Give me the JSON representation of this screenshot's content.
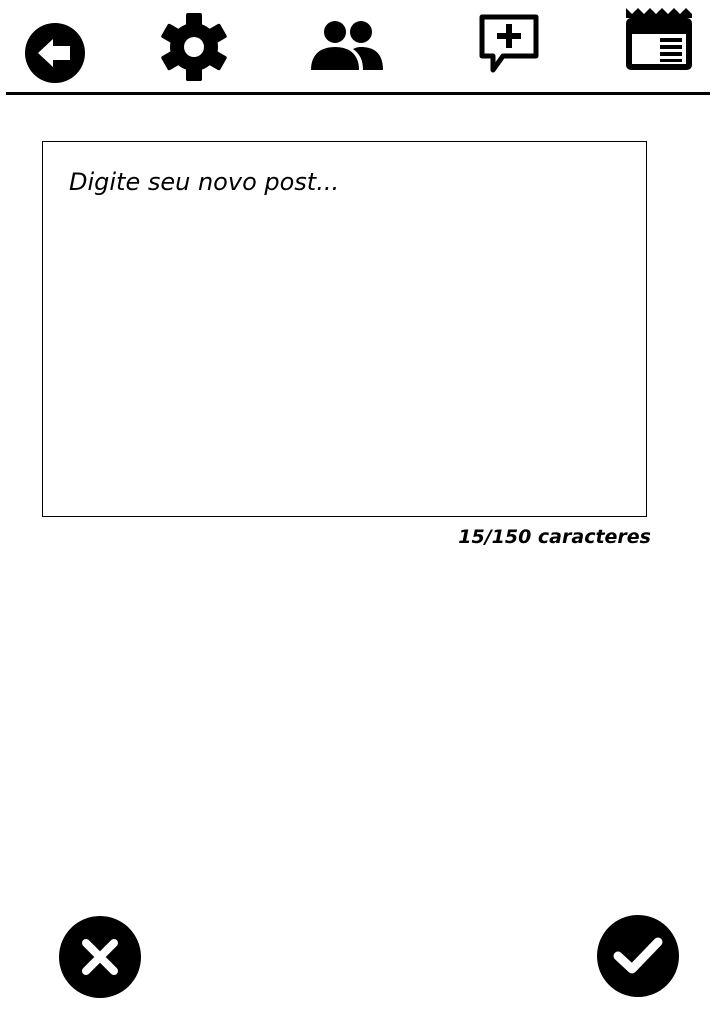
{
  "toolbar": {
    "icons": [
      {
        "name": "back-arrow-icon",
        "label": "Voltar"
      },
      {
        "name": "gear-icon",
        "label": "Configurações"
      },
      {
        "name": "people-icon",
        "label": "Amigos"
      },
      {
        "name": "add-comment-icon",
        "label": "Novo post"
      },
      {
        "name": "newspaper-icon",
        "label": "Feed"
      }
    ]
  },
  "post": {
    "placeholder": "Digite seu novo post...",
    "value": "",
    "counter": "15/150 caracteres"
  },
  "actions": {
    "cancel_icon": "close-icon",
    "confirm_icon": "check-icon"
  },
  "colors": {
    "foreground": "#000000",
    "background": "#ffffff"
  }
}
